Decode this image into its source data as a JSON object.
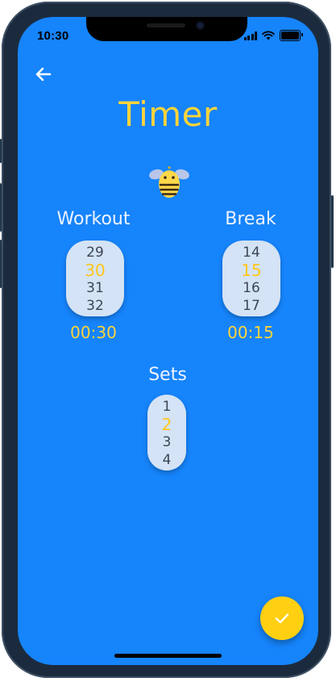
{
  "status_bar": {
    "time": "10:30"
  },
  "header": {
    "title": "Timer"
  },
  "workout": {
    "label": "Workout",
    "options": [
      "29",
      "30",
      "31",
      "32"
    ],
    "selected_index": 1,
    "readout": "00:30"
  },
  "break": {
    "label": "Break",
    "options": [
      "14",
      "15",
      "16",
      "17"
    ],
    "selected_index": 1,
    "readout": "00:15"
  },
  "sets": {
    "label": "Sets",
    "options": [
      "1",
      "2",
      "3",
      "4"
    ],
    "selected_index": 1
  },
  "icons": {
    "back": "arrow-left-icon",
    "mascot": "bee-icon",
    "confirm": "checkmark-icon"
  },
  "colors": {
    "background": "#1684fb",
    "accent": "#ffd43b",
    "fab": "#ffcf12",
    "picker": "#d4e3f5"
  }
}
